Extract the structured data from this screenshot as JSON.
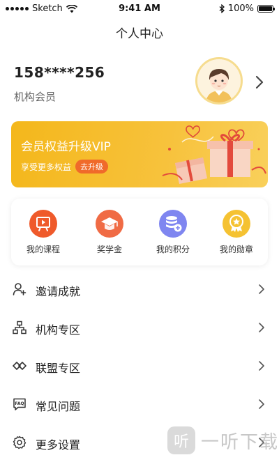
{
  "status_bar": {
    "carrier": "Sketch",
    "time": "9:41 AM",
    "battery_text": "100%",
    "battery_level": 1.0
  },
  "nav": {
    "title": "个人中心"
  },
  "profile": {
    "phone": "158****256",
    "member_type": "机构会员"
  },
  "vip_banner": {
    "title": "会员权益升级VIP",
    "subtitle": "享受更多权益",
    "button": "去升级"
  },
  "quick_actions": [
    {
      "label": "我的课程",
      "icon": "course-play-icon",
      "color": "#ef5a2b"
    },
    {
      "label": "奖学金",
      "icon": "graduation-cap-icon",
      "color": "#f06b45"
    },
    {
      "label": "我的积分",
      "icon": "coins-stack-icon",
      "color": "#7f86f0"
    },
    {
      "label": "我的勋章",
      "icon": "medal-icon",
      "color": "#f5c232"
    }
  ],
  "menu": [
    {
      "label": "邀请成就",
      "icon": "invite-user-icon"
    },
    {
      "label": "机构专区",
      "icon": "org-structure-icon"
    },
    {
      "label": "联盟专区",
      "icon": "alliance-icon"
    },
    {
      "label": "常见问题",
      "icon": "faq-icon"
    },
    {
      "label": "更多设置",
      "icon": "settings-gear-icon"
    }
  ],
  "watermark": {
    "text": "一听下载",
    "logo_text": "听"
  }
}
